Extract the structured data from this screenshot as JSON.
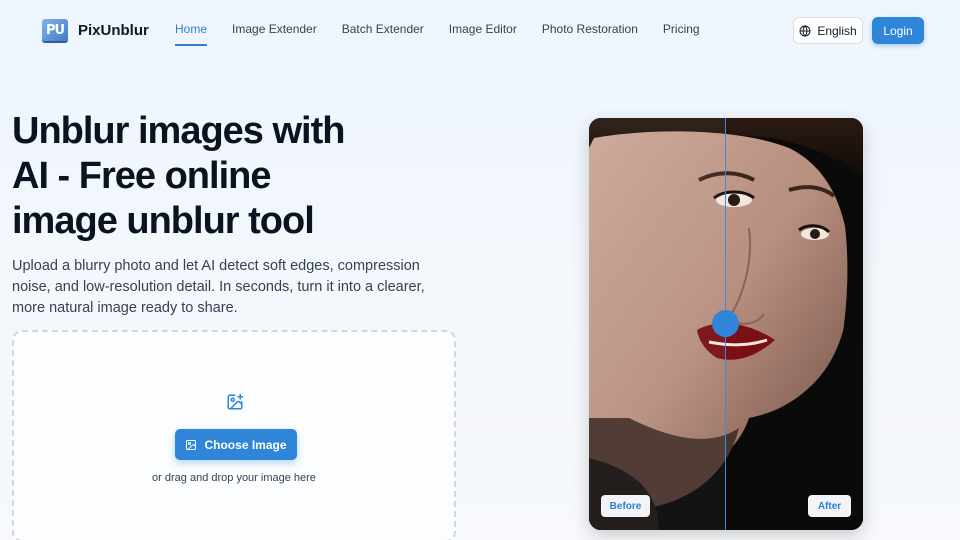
{
  "app": {
    "logo_mark": "PU",
    "logo_name": "PixUnblur"
  },
  "nav": {
    "items": [
      {
        "label": "Home",
        "active": true
      },
      {
        "label": "Image Extender"
      },
      {
        "label": "Batch Extender"
      },
      {
        "label": "Image Editor"
      },
      {
        "label": "Photo Restoration"
      },
      {
        "label": "Pricing"
      }
    ],
    "language": "English",
    "login": "Login"
  },
  "hero": {
    "title_line1": "Unblur images with",
    "title_line2": "AI - Free online",
    "title_line3": "image unblur tool",
    "subtitle": "Upload a blurry photo and let AI detect soft edges, compression noise, and low-resolution detail. In seconds, turn it into a clearer, more natural image ready to share."
  },
  "upload": {
    "icon": "image-plus-icon",
    "button_label": "Choose Image",
    "hint": "or drag and drop your image here"
  },
  "compare": {
    "before_label": "Before",
    "after_label": "After",
    "slider_position": 0.5
  },
  "colors": {
    "accent": "#2f86d9",
    "title": "#0b1220",
    "text": "#374151"
  }
}
